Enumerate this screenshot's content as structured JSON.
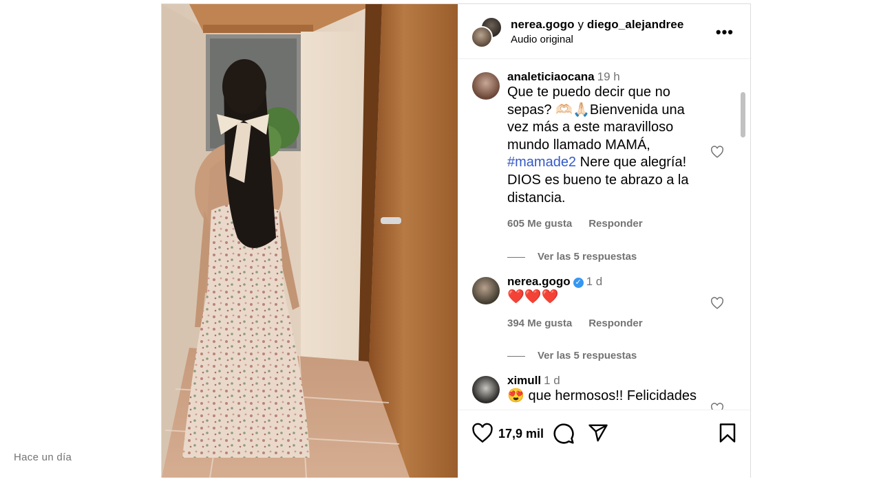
{
  "header": {
    "user1": "nerea.gogo",
    "joiner": "y",
    "user2": "diego_alejandree",
    "audio": "Audio original",
    "more_icon": "more-horizontal-icon"
  },
  "comments": [
    {
      "user": "analeticiaocana",
      "time": "19 h",
      "text_1": "Que te puedo decir que no sepas? 🫶🏻🙏🏻Bienvenida una vez más a este maravilloso mundo llamado MAMÁ, ",
      "hashtag": "#mamade2",
      "text_2": " Nere que alegría! DIOS es bueno te abrazo a la distancia.",
      "likes": "605 Me gusta",
      "reply": "Responder",
      "replies": "Ver las 5 respuestas"
    },
    {
      "user": "nerea.gogo",
      "verified": true,
      "time": "1 d",
      "text_1": "❤️❤️❤️",
      "likes": "394 Me gusta",
      "reply": "Responder",
      "replies": "Ver las 5 respuestas"
    },
    {
      "user": "ximull",
      "time": "1 d",
      "text_1": "😍 que hermosos!! Felicidades"
    }
  ],
  "footer": {
    "likes_count": "17,9 mil",
    "time_ago": "Hace un día",
    "icons": [
      "heart-icon",
      "comment-icon",
      "share-icon",
      "bookmark-icon"
    ]
  },
  "colors": {
    "hashtag": "#3458c8",
    "muted": "#737373",
    "verified": "#3797f0"
  }
}
